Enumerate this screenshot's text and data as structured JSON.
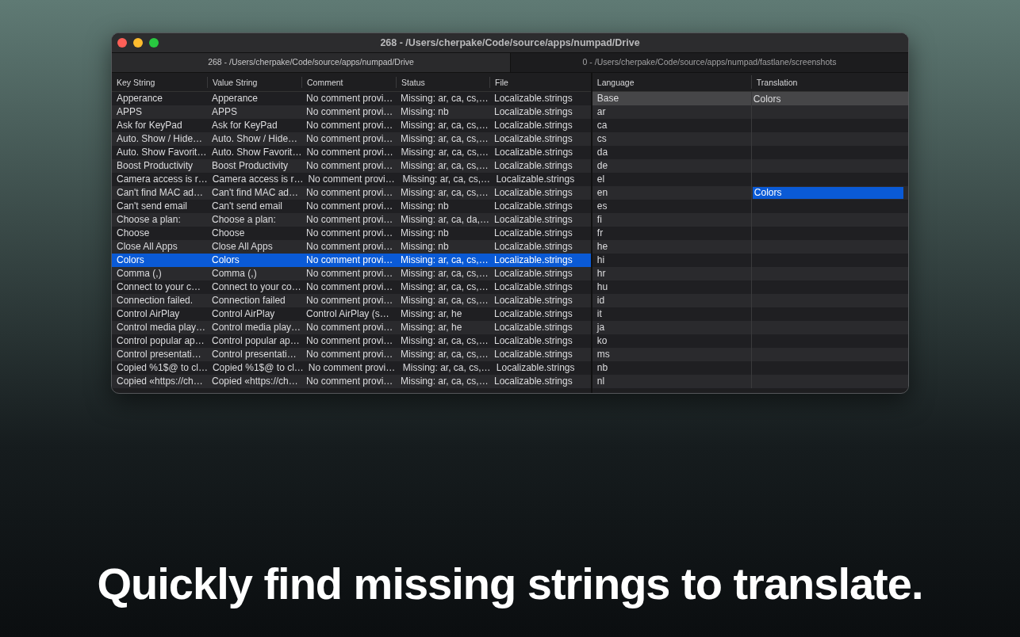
{
  "window": {
    "title": "268 - /Users/cherpake/Code/source/apps/numpad/Drive"
  },
  "tabs": [
    {
      "label": "268 - /Users/cherpake/Code/source/apps/numpad/Drive",
      "selected": true
    },
    {
      "label": "0 - /Users/cherpake/Code/source/apps/numpad/fastlane/screenshots",
      "selected": false
    }
  ],
  "strings_table": {
    "columns": [
      "Key String",
      "Value String",
      "Comment",
      "Status",
      "File"
    ],
    "rows": [
      {
        "cells": [
          "Apperance",
          "Apperance",
          "No comment provi…",
          "Missing: ar, ca, cs,…",
          "Localizable.strings"
        ],
        "selected": false
      },
      {
        "cells": [
          "APPS",
          "APPS",
          "No comment provi…",
          "Missing: nb",
          "Localizable.strings"
        ],
        "selected": false
      },
      {
        "cells": [
          "Ask for KeyPad",
          "Ask for KeyPad",
          "No comment provi…",
          "Missing: ar, ca, cs,…",
          "Localizable.strings"
        ],
        "selected": false
      },
      {
        "cells": [
          "Auto. Show / Hide…",
          "Auto. Show / Hide…",
          "No comment provi…",
          "Missing: ar, ca, cs,…",
          "Localizable.strings"
        ],
        "selected": false
      },
      {
        "cells": [
          "Auto. Show Favorit…",
          "Auto. Show Favorit…",
          "No comment provi…",
          "Missing: ar, ca, cs,…",
          "Localizable.strings"
        ],
        "selected": false
      },
      {
        "cells": [
          "Boost Productivity",
          "Boost Productivity",
          "No comment provi…",
          "Missing: ar, ca, cs,…",
          "Localizable.strings"
        ],
        "selected": false
      },
      {
        "cells": [
          "Camera access is r…",
          "Camera access is r…",
          "No comment provi…",
          "Missing: ar, ca, cs,…",
          "Localizable.strings"
        ],
        "selected": false
      },
      {
        "cells": [
          "Can't find MAC ad…",
          "Can't find MAC ad…",
          "No comment provi…",
          "Missing: ar, ca, cs,…",
          "Localizable.strings"
        ],
        "selected": false
      },
      {
        "cells": [
          "Can't send email",
          "Can't send email",
          "No comment provi…",
          "Missing: nb",
          "Localizable.strings"
        ],
        "selected": false
      },
      {
        "cells": [
          "Choose a plan:",
          "Choose a plan:",
          "No comment provi…",
          "Missing: ar, ca, da,…",
          "Localizable.strings"
        ],
        "selected": false
      },
      {
        "cells": [
          "Choose",
          "Choose",
          "No comment provi…",
          "Missing: nb",
          "Localizable.strings"
        ],
        "selected": false
      },
      {
        "cells": [
          "Close All Apps",
          "Close All Apps",
          "No comment provi…",
          "Missing: nb",
          "Localizable.strings"
        ],
        "selected": false
      },
      {
        "cells": [
          "Colors",
          "Colors",
          "No comment provi…",
          "Missing: ar, ca, cs,…",
          "Localizable.strings"
        ],
        "selected": true
      },
      {
        "cells": [
          "Comma (,)",
          "Comma (,)",
          "No comment provi…",
          "Missing: ar, ca, cs,…",
          "Localizable.strings"
        ],
        "selected": false
      },
      {
        "cells": [
          "Connect to your c…",
          "Connect to your co…",
          "No comment provi…",
          "Missing: ar, ca, cs,…",
          "Localizable.strings"
        ],
        "selected": false
      },
      {
        "cells": [
          "Connection failed.",
          "Connection failed",
          "No comment provi…",
          "Missing: ar, ca, cs,…",
          "Localizable.strings"
        ],
        "selected": false
      },
      {
        "cells": [
          "Control AirPlay",
          "Control AirPlay",
          "Control AirPlay (s…",
          "Missing: ar, he",
          "Localizable.strings"
        ],
        "selected": false
      },
      {
        "cells": [
          "Control media play…",
          "Control media play…",
          "No comment provi…",
          "Missing: ar, he",
          "Localizable.strings"
        ],
        "selected": false
      },
      {
        "cells": [
          "Control popular ap…",
          "Control popular ap…",
          "No comment provi…",
          "Missing: ar, ca, cs,…",
          "Localizable.strings"
        ],
        "selected": false
      },
      {
        "cells": [
          "Control presentati…",
          "Control presentati…",
          "No comment provi…",
          "Missing: ar, ca, cs,…",
          "Localizable.strings"
        ],
        "selected": false
      },
      {
        "cells": [
          "Copied %1$@ to cl…",
          "Copied %1$@ to cl…",
          "No comment provi…",
          "Missing: ar, ca, cs,…",
          "Localizable.strings"
        ],
        "selected": false
      },
      {
        "cells": [
          "Copied «https://ch…",
          "Copied «https://ch…",
          "No comment provi…",
          "Missing: ar, ca, cs,…",
          "Localizable.strings"
        ],
        "selected": false
      }
    ]
  },
  "translations_table": {
    "columns": [
      "Language",
      "Translation"
    ],
    "rows": [
      {
        "language": "Base",
        "translation": "Colors",
        "selected": true,
        "editing": false
      },
      {
        "language": "ar",
        "selected": false,
        "editing": false
      },
      {
        "language": "ca",
        "selected": false,
        "editing": false
      },
      {
        "language": "cs",
        "selected": false,
        "editing": false
      },
      {
        "language": "da",
        "selected": false,
        "editing": false
      },
      {
        "language": "de",
        "selected": false,
        "editing": false
      },
      {
        "language": "el",
        "selected": false,
        "editing": false
      },
      {
        "language": "en",
        "translation": "Colors",
        "selected": false,
        "editing": true
      },
      {
        "language": "es",
        "selected": false,
        "editing": false
      },
      {
        "language": "fi",
        "selected": false,
        "editing": false
      },
      {
        "language": "fr",
        "selected": false,
        "editing": false
      },
      {
        "language": "he",
        "selected": false,
        "editing": false
      },
      {
        "language": "hi",
        "selected": false,
        "editing": false
      },
      {
        "language": "hr",
        "selected": false,
        "editing": false
      },
      {
        "language": "hu",
        "selected": false,
        "editing": false
      },
      {
        "language": "id",
        "selected": false,
        "editing": false
      },
      {
        "language": "it",
        "selected": false,
        "editing": false
      },
      {
        "language": "ja",
        "selected": false,
        "editing": false
      },
      {
        "language": "ko",
        "selected": false,
        "editing": false
      },
      {
        "language": "ms",
        "selected": false,
        "editing": false
      },
      {
        "language": "nb",
        "selected": false,
        "editing": false
      },
      {
        "language": "nl",
        "selected": false,
        "editing": false
      }
    ]
  },
  "caption": "Quickly find missing strings to translate."
}
